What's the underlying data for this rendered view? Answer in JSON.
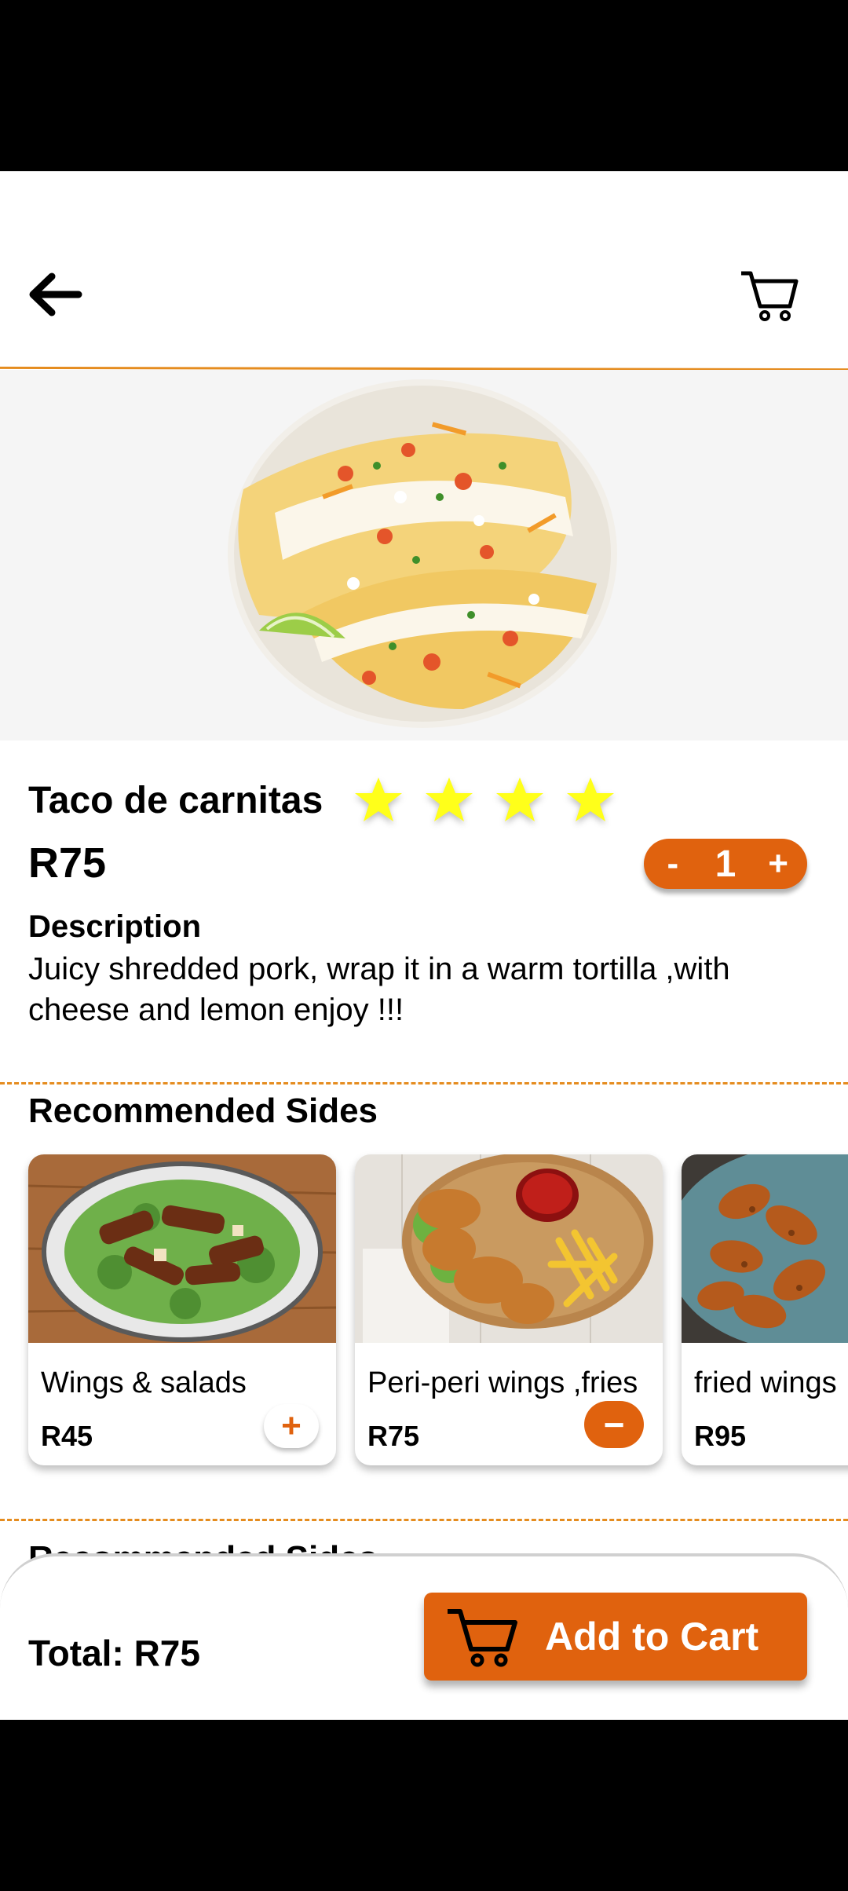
{
  "product": {
    "name": "Taco de carnitas",
    "rating": 4,
    "price": "R75",
    "quantity": {
      "minus": "-",
      "value": "1",
      "plus": "+"
    },
    "description_heading": "Description",
    "description": "Juicy shredded pork, wrap it in a warm tortilla ,with cheese and lemon enjoy !!!"
  },
  "recommended": {
    "heading": "Recommended Sides",
    "items": [
      {
        "name": "Wings & salads",
        "price": "R45",
        "action": "+"
      },
      {
        "name": "Peri-peri  wings ,fries",
        "price": "R75",
        "action": "−"
      },
      {
        "name": "fried wings",
        "price": "R95"
      }
    ]
  },
  "recommended_repeat_heading": "Recommended Sides",
  "footer": {
    "total": "Total: R75",
    "add_to_cart_label": "Add to Cart"
  },
  "colors": {
    "accent": "#e0620e",
    "rule": "#e58c1f",
    "star": "#ffff1a"
  },
  "icons": [
    "back-arrow-icon",
    "cart-icon",
    "star-icon",
    "plus-icon",
    "minus-icon"
  ]
}
